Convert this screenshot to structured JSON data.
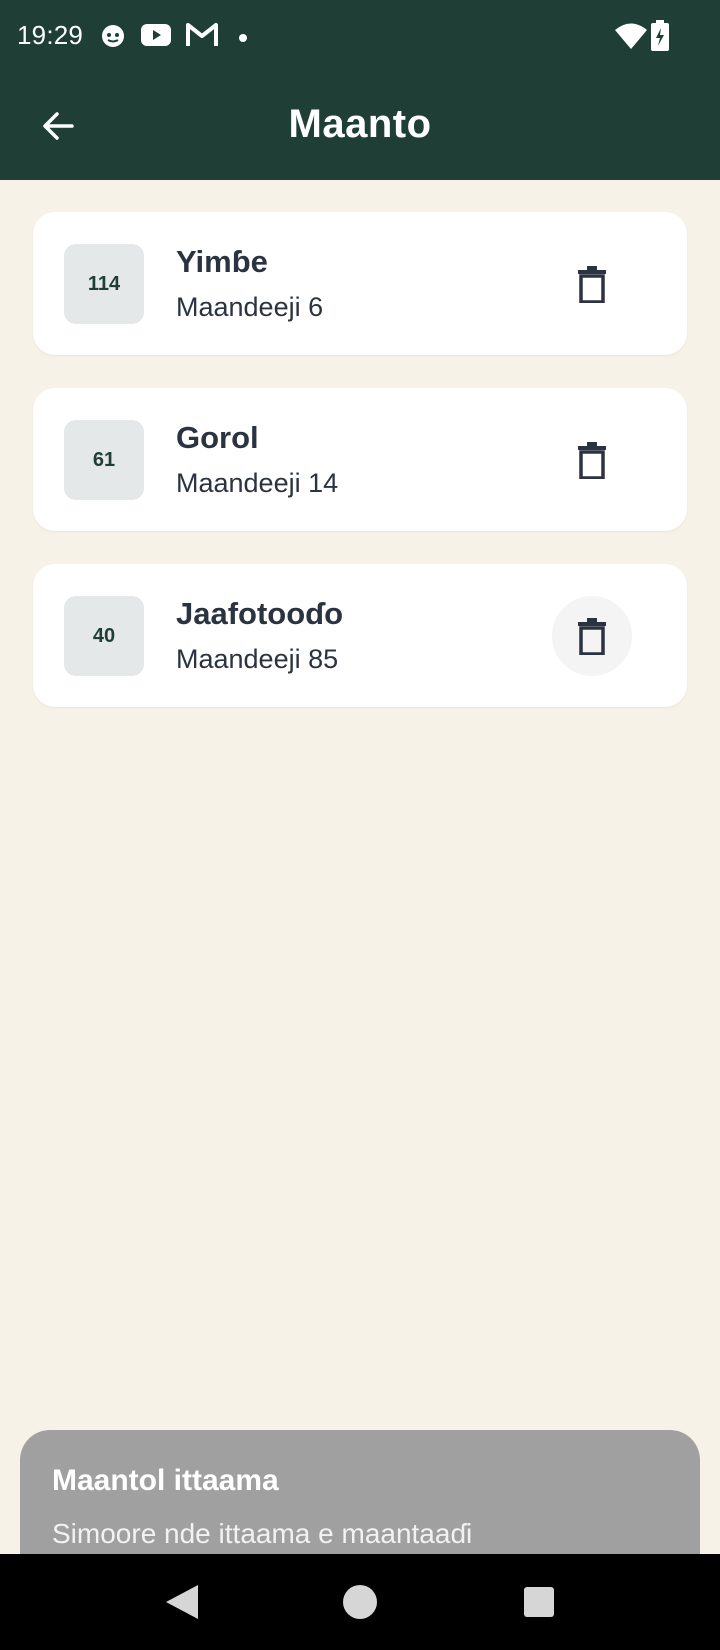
{
  "status_bar": {
    "time": "19:29",
    "notification_icons": [
      "cat-icon",
      "youtube-icon",
      "gmail-icon",
      "dot-icon"
    ],
    "system_icons": [
      "wifi-icon",
      "battery-charging-icon"
    ]
  },
  "app_bar": {
    "title": "Maanto",
    "back_icon": "arrow-left-icon"
  },
  "items": [
    {
      "count": "114",
      "title": "Yimɓe",
      "subtitle": "Maandeeji 6"
    },
    {
      "count": "61",
      "title": "Gorol",
      "subtitle": "Maandeeji 14"
    },
    {
      "count": "40",
      "title": "Jaafotooɗo",
      "subtitle": "Maandeeji 85"
    }
  ],
  "sheet": {
    "title": "Maantol ittaama",
    "subtitle": "Simoore nde ittaama e maantaaɗi"
  },
  "colors": {
    "primary": "#1f3f36",
    "background": "#f6f2e8",
    "card": "#ffffff",
    "text": "#2b3340",
    "badge_bg": "#e5e8e8",
    "sheet_bg": "#a0a0a0"
  }
}
